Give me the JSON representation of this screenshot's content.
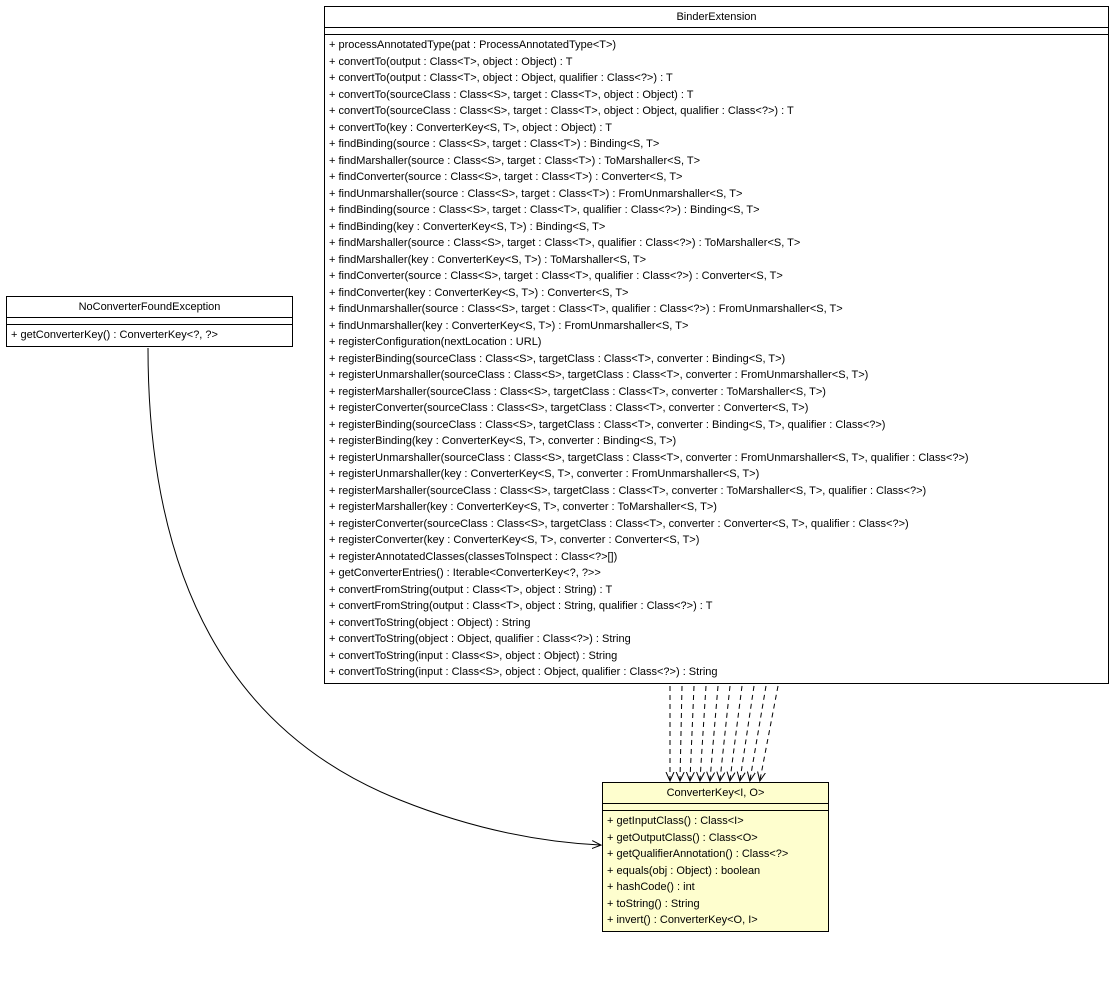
{
  "classes": {
    "noConverter": {
      "name": "NoConverterFoundException",
      "methods": [
        "+ getConverterKey() : ConverterKey<?, ?>"
      ]
    },
    "binderExtension": {
      "name": "BinderExtension",
      "methods": [
        "+ processAnnotatedType(pat : ProcessAnnotatedType<T>)",
        "+ convertTo(output : Class<T>, object : Object) : T",
        "+ convertTo(output : Class<T>, object : Object, qualifier : Class<?>) : T",
        "+ convertTo(sourceClass : Class<S>, target : Class<T>, object : Object) : T",
        "+ convertTo(sourceClass : Class<S>, target : Class<T>, object : Object, qualifier : Class<?>) : T",
        "+ convertTo(key : ConverterKey<S, T>, object : Object) : T",
        "+ findBinding(source : Class<S>, target : Class<T>) : Binding<S, T>",
        "+ findMarshaller(source : Class<S>, target : Class<T>) : ToMarshaller<S, T>",
        "+ findConverter(source : Class<S>, target : Class<T>) : Converter<S, T>",
        "+ findUnmarshaller(source : Class<S>, target : Class<T>) : FromUnmarshaller<S, T>",
        "+ findBinding(source : Class<S>, target : Class<T>, qualifier : Class<?>) : Binding<S, T>",
        "+ findBinding(key : ConverterKey<S, T>) : Binding<S, T>",
        "+ findMarshaller(source : Class<S>, target : Class<T>, qualifier : Class<?>) : ToMarshaller<S, T>",
        "+ findMarshaller(key : ConverterKey<S, T>) : ToMarshaller<S, T>",
        "+ findConverter(source : Class<S>, target : Class<T>, qualifier : Class<?>) : Converter<S, T>",
        "+ findConverter(key : ConverterKey<S, T>) : Converter<S, T>",
        "+ findUnmarshaller(source : Class<S>, target : Class<T>, qualifier : Class<?>) : FromUnmarshaller<S, T>",
        "+ findUnmarshaller(key : ConverterKey<S, T>) : FromUnmarshaller<S, T>",
        "+ registerConfiguration(nextLocation : URL)",
        "+ registerBinding(sourceClass : Class<S>, targetClass : Class<T>, converter : Binding<S, T>)",
        "+ registerUnmarshaller(sourceClass : Class<S>, targetClass : Class<T>, converter : FromUnmarshaller<S, T>)",
        "+ registerMarshaller(sourceClass : Class<S>, targetClass : Class<T>, converter : ToMarshaller<S, T>)",
        "+ registerConverter(sourceClass : Class<S>, targetClass : Class<T>, converter : Converter<S, T>)",
        "+ registerBinding(sourceClass : Class<S>, targetClass : Class<T>, converter : Binding<S, T>, qualifier : Class<?>)",
        "+ registerBinding(key : ConverterKey<S, T>, converter : Binding<S, T>)",
        "+ registerUnmarshaller(sourceClass : Class<S>, targetClass : Class<T>, converter : FromUnmarshaller<S, T>, qualifier : Class<?>)",
        "+ registerUnmarshaller(key : ConverterKey<S, T>, converter : FromUnmarshaller<S, T>)",
        "+ registerMarshaller(sourceClass : Class<S>, targetClass : Class<T>, converter : ToMarshaller<S, T>, qualifier : Class<?>)",
        "+ registerMarshaller(key : ConverterKey<S, T>, converter : ToMarshaller<S, T>)",
        "+ registerConverter(sourceClass : Class<S>, targetClass : Class<T>, converter : Converter<S, T>, qualifier : Class<?>)",
        "+ registerConverter(key : ConverterKey<S, T>, converter : Converter<S, T>)",
        "+ registerAnnotatedClasses(classesToInspect : Class<?>[])",
        "+ getConverterEntries() : Iterable<ConverterKey<?, ?>>",
        "+ convertFromString(output : Class<T>, object : String) : T",
        "+ convertFromString(output : Class<T>, object : String, qualifier : Class<?>) : T",
        "+ convertToString(object : Object) : String",
        "+ convertToString(object : Object, qualifier : Class<?>) : String",
        "+ convertToString(input : Class<S>, object : Object) : String",
        "+ convertToString(input : Class<S>, object : Object, qualifier : Class<?>) : String"
      ]
    },
    "converterKey": {
      "name": "ConverterKey<I, O>",
      "methods": [
        "+ getInputClass() : Class<I>",
        "+ getOutputClass() : Class<O>",
        "+ getQualifierAnnotation() : Class<?>",
        "+ equals(obj : Object) : boolean",
        "+ hashCode() : int",
        "+ toString() : String",
        "+ invert() : ConverterKey<O, I>"
      ]
    }
  }
}
